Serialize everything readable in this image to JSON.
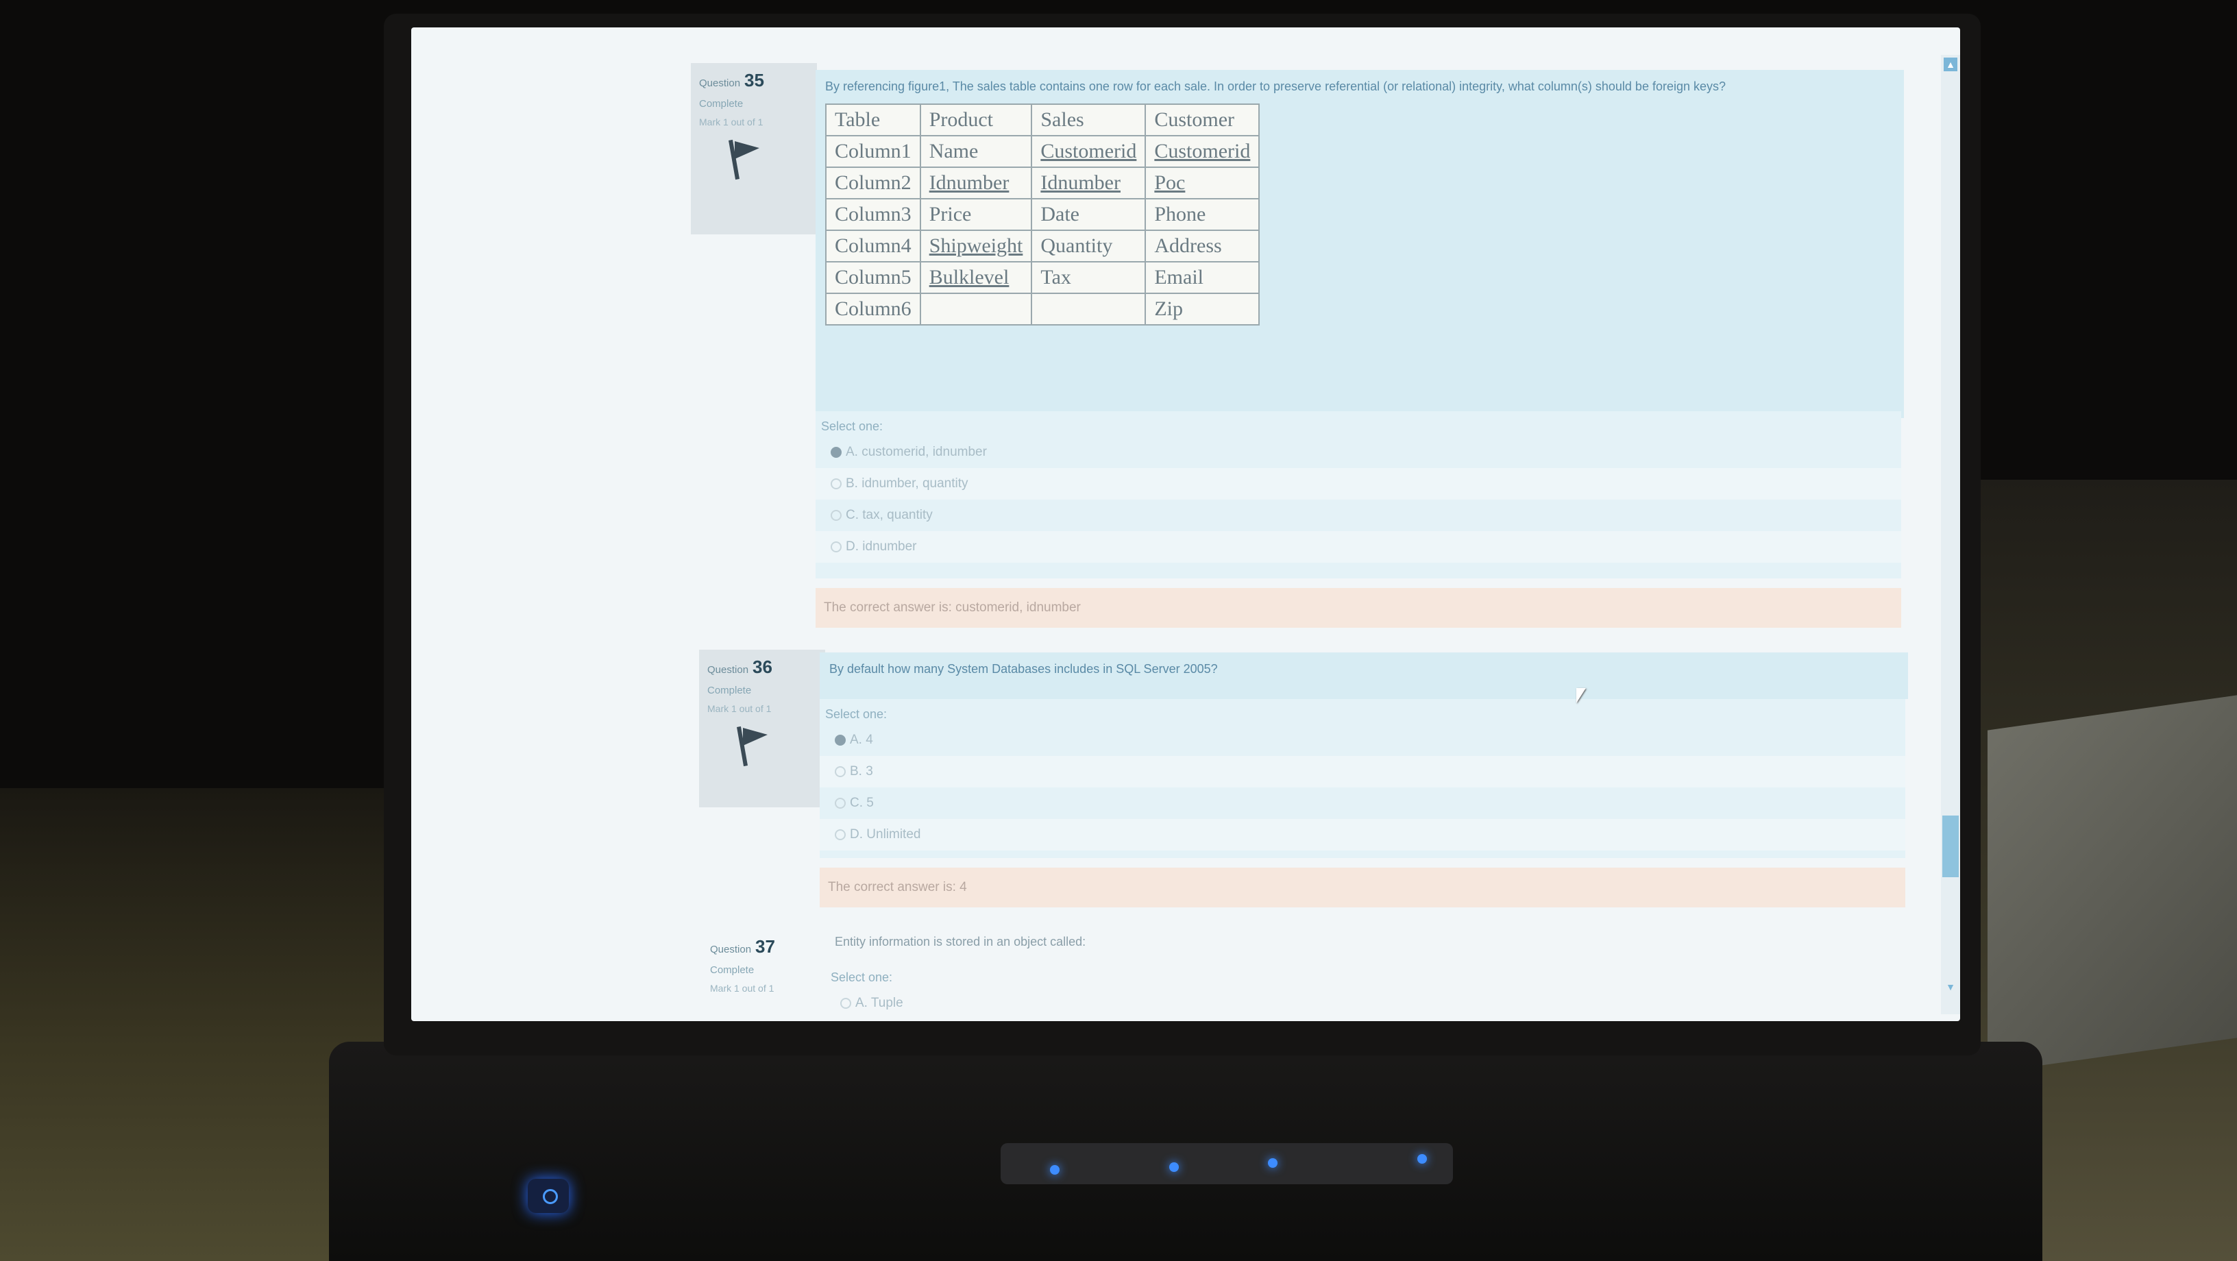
{
  "questions": [
    {
      "label": "Question",
      "number": "35",
      "state": "Complete",
      "mark": "Mark 1 out of 1",
      "text": "By referencing figure1, The sales table contains one row for each sale. In order to preserve referential (or relational) integrity, what column(s) should be foreign keys?",
      "table": {
        "headers": [
          "Table",
          "Product",
          "Sales",
          "Customer"
        ],
        "rows": [
          [
            "Column1",
            "Name",
            "Customerid",
            "Customerid"
          ],
          [
            "Column2",
            "Idnumber",
            "Idnumber",
            "Poc"
          ],
          [
            "Column3",
            "Price",
            "Date",
            "Phone"
          ],
          [
            "Column4",
            "Shipweight",
            "Quantity",
            "Address"
          ],
          [
            "Column5",
            "Bulklevel",
            "Tax",
            "Email"
          ],
          [
            "Column6",
            "",
            "",
            "Zip"
          ]
        ]
      },
      "select_label": "Select one:",
      "options": [
        "A. customerid, idnumber",
        "B. idnumber, quantity",
        "C. tax, quantity",
        "D. idnumber"
      ],
      "selected": "A. customerid, idnumber",
      "feedback": "The correct answer is: customerid, idnumber"
    },
    {
      "label": "Question",
      "number": "36",
      "state": "Complete",
      "mark": "Mark 1 out of 1",
      "text": "By default how many System Databases includes in SQL Server 2005?",
      "select_label": "Select one:",
      "options": [
        "A. 4",
        "B. 3",
        "C. 5",
        "D. Unlimited"
      ],
      "selected": "A. 4",
      "feedback": "The correct answer is: 4"
    },
    {
      "label": "Question",
      "number": "37",
      "state": "Complete",
      "mark": "Mark 1 out of 1",
      "text": "Entity information is stored in an object called:",
      "select_label": "Select one:",
      "options": [
        "A. Tuple"
      ]
    }
  ],
  "icons": [
    "flag-icon",
    "mouse-cursor-icon",
    "power-icon"
  ],
  "colors": {
    "question_bg": "#d7ecf3",
    "feedback_bg": "#f6e7dd",
    "led": "#3d8cff"
  }
}
